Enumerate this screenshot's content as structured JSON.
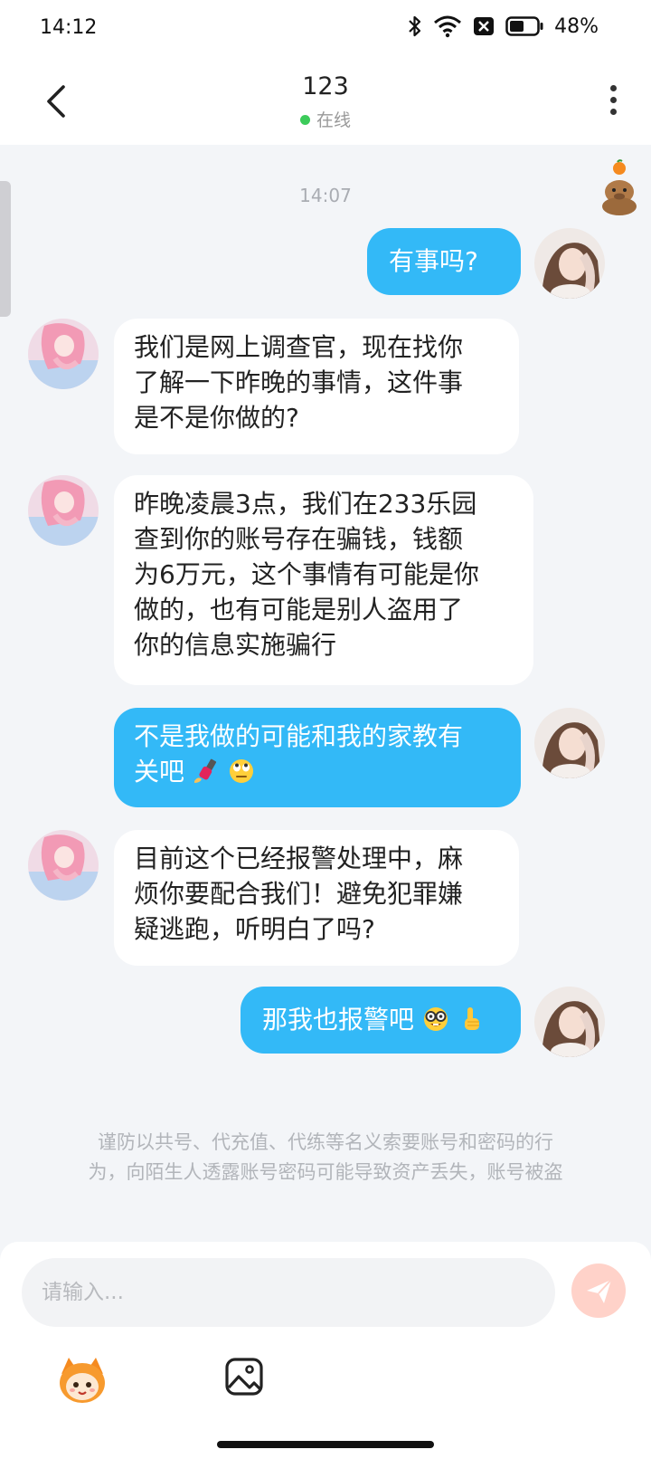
{
  "status_bar": {
    "time": "14:12",
    "battery_text": "48%",
    "icons": [
      "bluetooth-icon",
      "wifi-icon",
      "no-sim-icon",
      "battery-icon"
    ]
  },
  "header": {
    "title": "123",
    "status": "在线",
    "back_icon": "back-arrow-icon",
    "more_icon": "more-vertical-icon"
  },
  "chat": {
    "timestamp": "14:07",
    "messages": [
      {
        "sender": "self",
        "text": "有事吗?"
      },
      {
        "sender": "other",
        "lines": [
          "我们是网上调查官，现在找你",
          "了解一下昨晚的事情，这件事",
          "是不是你做的?"
        ]
      },
      {
        "sender": "other",
        "lines": [
          "昨晚凌晨3点，我们在233乐园",
          "查到你的账号存在骗钱，钱额",
          "为6万元，这个事情有可能是你",
          "做的，也有可能是别人盗用了",
          "你的信息实施骗行"
        ]
      },
      {
        "sender": "self",
        "lines": [
          "不是我做的可能和我的家教有",
          "关吧"
        ],
        "emojis": [
          "nail-polish-emoji",
          "eye-roll-emoji"
        ]
      },
      {
        "sender": "other",
        "lines": [
          "目前这个已经报警处理中，麻",
          "烦你要配合我们！避免犯罪嫌",
          "疑逃跑，听明白了吗?"
        ]
      },
      {
        "sender": "self",
        "text": "那我也报警吧",
        "emojis": [
          "nerd-face-emoji",
          "pointing-up-emoji"
        ]
      }
    ]
  },
  "notice": {
    "lines": [
      "谨防以共号、代充值、代练等名义索要账号和密码的行",
      "为，向陌生人透露账号密码可能导致资产丢失，账号被盗"
    ]
  },
  "composer": {
    "placeholder": "请输入...",
    "send_icon": "send-icon",
    "tools": [
      "mascot-sticker-icon",
      "image-icon"
    ]
  }
}
